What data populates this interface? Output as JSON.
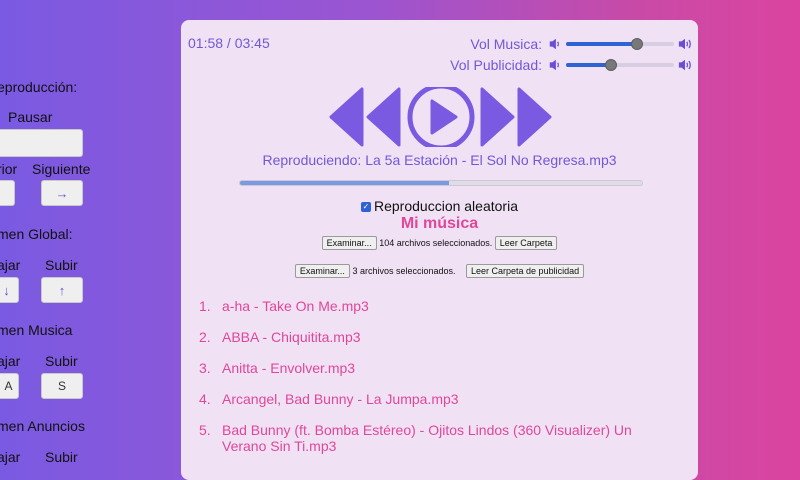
{
  "left_panel": {
    "playback_label": "eproducción:",
    "pause_label": "Pausar",
    "prev_label": "rior",
    "next_label": "Siguiente",
    "next_icon": "→",
    "global_volume_label": "men Global:",
    "down_label": "ajar",
    "up_label": "Subir",
    "down_icon": "↓",
    "up_icon": "↑",
    "music_volume_label": "men Musica",
    "music_down_label": "ajar",
    "music_up_label": "Subir",
    "music_down_key": "A",
    "music_up_key": "S",
    "ads_volume_label": "men Anuncios",
    "ads_down_label": "ajar",
    "ads_up_label": "Subir"
  },
  "player": {
    "time": "01:58 / 03:45",
    "vol_music_label": "Vol Musica:",
    "vol_music_level": 0.66,
    "vol_ads_label": "Vol Publicidad:",
    "vol_ads_level": 0.42,
    "now_playing": "Reproduciendo: La 5a Estación - El Sol No Regresa.mp3",
    "progress": 0.52,
    "shuffle_label": "Reproduccion aleatoria",
    "shuffle_checked": true,
    "section_title": "Mi música",
    "browse_label": "Examinar...",
    "music_files_status": "104 archivos seleccionados.",
    "read_folder_label": "Leer Carpeta",
    "ads_browse_label": "Examinar...",
    "ads_files_status": "3 archivos seleccionados.",
    "read_ads_folder_label": "Leer Carpeta de publicidad"
  },
  "playlist": [
    {
      "num": "1.",
      "title": "a-ha - Take On Me.mp3"
    },
    {
      "num": "2.",
      "title": "ABBA - Chiquitita.mp3"
    },
    {
      "num": "3.",
      "title": "Anitta - Envolver.mp3"
    },
    {
      "num": "4.",
      "title": "Arcangel, Bad Bunny - La Jumpa.mp3"
    },
    {
      "num": "5.",
      "title": "Bad Bunny (ft. Bomba Estéreo) - Ojitos Lindos (360 Visualizer) Un Verano Sin Ti.mp3"
    }
  ],
  "colors": {
    "accent": "#7258d6",
    "pink": "#e0479a",
    "slider_fill": "#2f62d4"
  }
}
